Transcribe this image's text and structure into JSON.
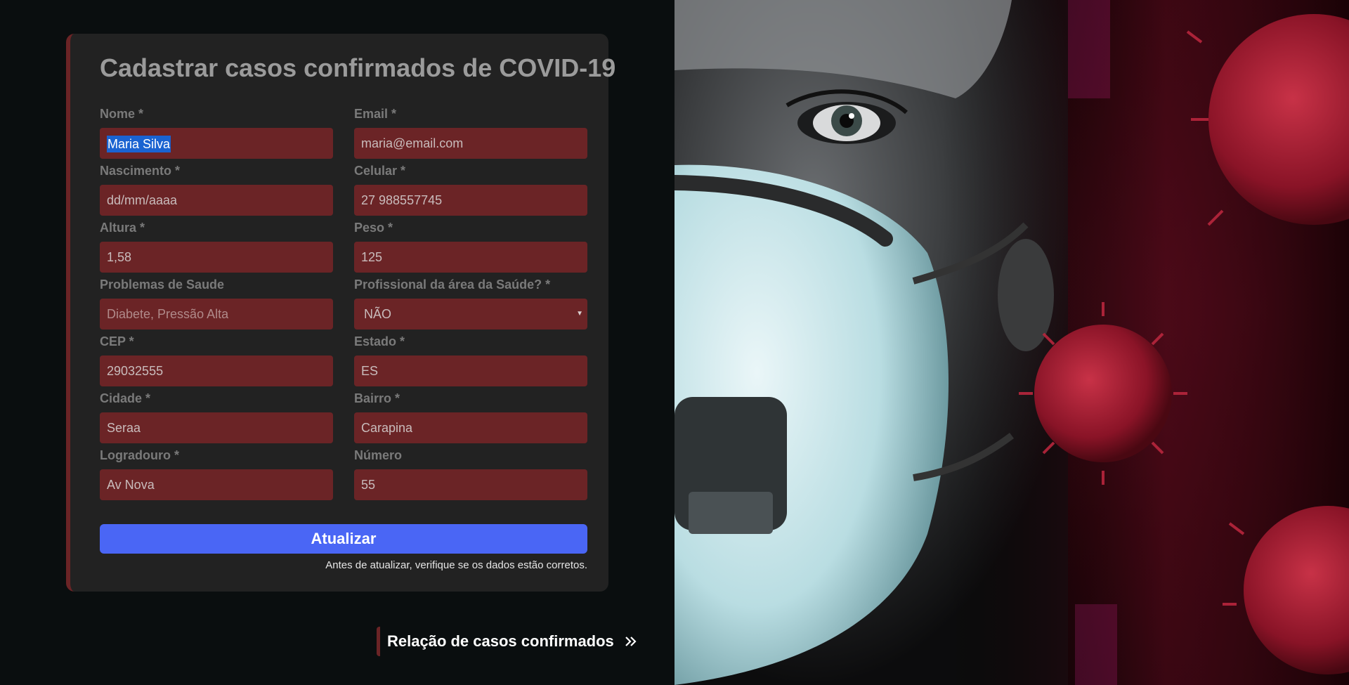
{
  "form": {
    "title": "Cadastrar casos confirmados de COVID-19",
    "fields": {
      "nome": {
        "label": "Nome *",
        "value": "Maria Silva"
      },
      "email": {
        "label": "Email *",
        "value": "maria@email.com"
      },
      "nascimento": {
        "label": "Nascimento *",
        "placeholder": "dd/mm/aaaa"
      },
      "celular": {
        "label": "Celular *",
        "value": "27 988557745"
      },
      "altura": {
        "label": "Altura *",
        "value": "1,58"
      },
      "peso": {
        "label": "Peso *",
        "value": "125"
      },
      "problemas": {
        "label": "Problemas de Saude",
        "placeholder": "Diabete, Pressão Alta"
      },
      "profissional": {
        "label": "Profissional da área da Saúde? *",
        "selected": "NÃO"
      },
      "cep": {
        "label": "CEP *",
        "value": "29032555"
      },
      "estado": {
        "label": "Estado *",
        "value": "ES"
      },
      "cidade": {
        "label": "Cidade *",
        "value": "Seraa"
      },
      "bairro": {
        "label": "Bairro *",
        "value": "Carapina"
      },
      "logradouro": {
        "label": "Logradouro *",
        "value": "Av Nova"
      },
      "numero": {
        "label": "Número",
        "value": "55"
      }
    },
    "submit_label": "Atualizar",
    "hint": "Antes de atualizar, verifique se os dados estão corretos."
  },
  "list_link": {
    "label": "Relação de casos confirmados",
    "icon": "double-chevron-right-icon"
  },
  "colors": {
    "page_bg": "#0a0e0f",
    "card_bg": "#222222",
    "accent_red": "#6b2426",
    "button_blue": "#4a66f5",
    "title_gray": "#9b9b9b",
    "label_gray": "#7a7a7a"
  },
  "hero_image": {
    "icon": "masked-person-virus-photo"
  }
}
